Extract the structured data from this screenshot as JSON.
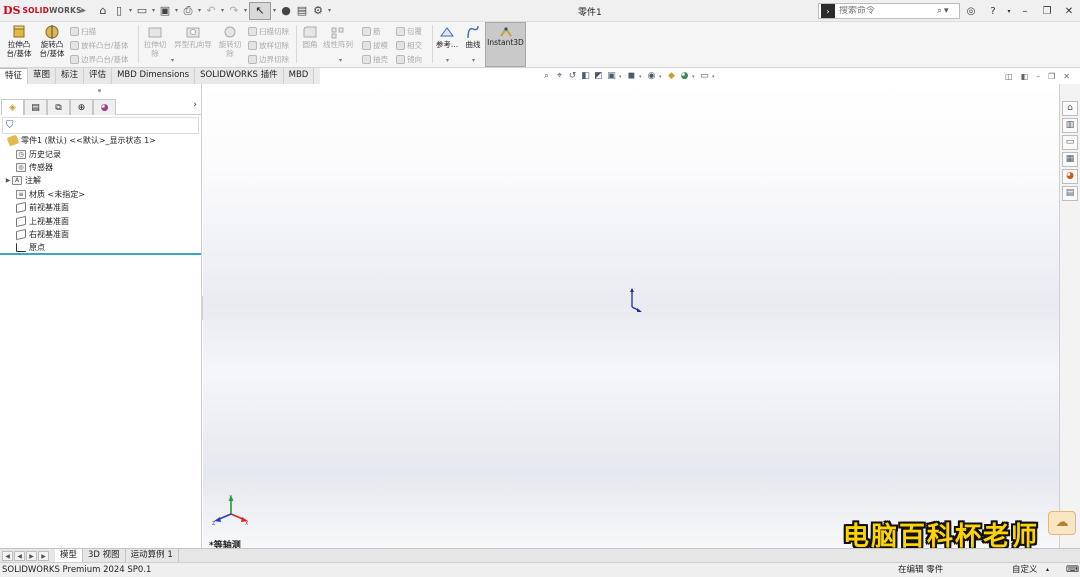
{
  "app": {
    "logo_mark": "DS",
    "logo_brand": "SOLID",
    "logo_brand2": "WORKS",
    "doc_title": "零件1"
  },
  "search": {
    "placeholder": "搜索命令",
    "icon": "search-icon"
  },
  "ribbon": {
    "extrude_boss": "拉伸凸台/基体",
    "revolve_boss": "旋转凸台/基体",
    "sweep": "扫描",
    "loft_boss": "放样凸台/基体",
    "boundary_boss": "边界凸台/基体",
    "extrude_cut": "拉伸切除",
    "hole_wizard": "异型孔向导",
    "revolve_cut": "旋转切除",
    "swept_cut": "扫描切除",
    "lofted_cut": "放样切除",
    "boundary_cut": "边界切除",
    "fillet": "圆角",
    "linear_pattern": "线性阵列",
    "rib": "筋",
    "draft": "拔模",
    "shell": "抽壳",
    "wrap": "包覆",
    "intersect": "相交",
    "mirror": "镜向",
    "reference_geometry": "参考...",
    "curves": "曲线",
    "instant3d": "Instant3D"
  },
  "command_tabs": [
    "特征",
    "草图",
    "标注",
    "评估",
    "MBD Dimensions",
    "SOLIDWORKS 插件",
    "MBD"
  ],
  "feature_tree": {
    "root": "零件1 (默认) <<默认>_显示状态 1>",
    "items": [
      "历史记录",
      "传感器",
      "注解",
      "材质 <未指定>",
      "前视基准面",
      "上视基准面",
      "右视基准面",
      "原点"
    ]
  },
  "viewport": {
    "view_name": "*等轴测"
  },
  "bottom_tabs": [
    "模型",
    "3D 视图",
    "运动算例 1"
  ],
  "status": {
    "product": "SOLIDWORKS Premium 2024 SP0.1",
    "mode": "在编辑 零件",
    "units": "自定义"
  },
  "watermark": "电脑百科杯老师",
  "colors": {
    "brand": "#d0021b",
    "accent": "#3da4c8",
    "watermark": "#ffd400"
  }
}
